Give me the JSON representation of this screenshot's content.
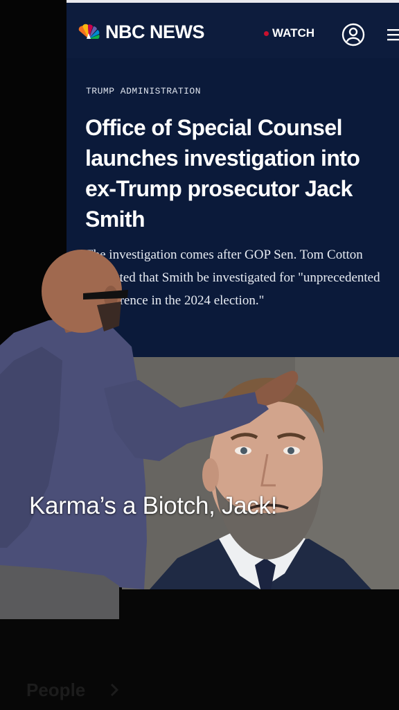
{
  "article": {
    "brand": "NBC NEWS",
    "watch_label": "WATCH",
    "kicker": "TRUMP ADMINISTRATION",
    "headline": "Office of Special Counsel launches investigation into ex-Trump prosecutor Jack Smith",
    "dek": "The investigation comes after GOP Sen. Tom Cotton requested that Smith be investigated for \"unprecedented interference in the 2024 election.\""
  },
  "overlay": {
    "caption": "Karma’s a Biotch, Jack!"
  },
  "footer": {
    "people_label": "People"
  },
  "icons": {
    "logo": "nbc-peacock-icon",
    "live_dot": "live-dot-icon",
    "account": "account-icon",
    "menu": "menu-icon",
    "chevron": "chevron-right-icon"
  },
  "colors": {
    "header_bg": "#0d1c3d",
    "article_bg": "#0b1a3a",
    "live_red": "#c8102e",
    "text_white": "#ffffff"
  }
}
